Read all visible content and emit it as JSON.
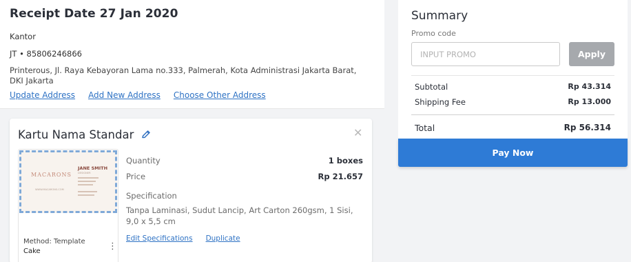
{
  "address": {
    "receipt_title": "Receipt Date 27 Jan 2020",
    "name": "Kantor",
    "phone": "JT • 85806246866",
    "line": "Printerous, Jl. Raya Kebayoran Lama no.333, Palmerah, Kota Administrasi Jakarta Barat, DKI Jakarta",
    "links": [
      "Update Address",
      "Add New Address",
      "Choose Other Address"
    ]
  },
  "product": {
    "title": "Kartu Nama Standar",
    "preview": {
      "logo": "MACARONS",
      "logo_sub": "WWW.MACARONS.COM",
      "name": "JANE SMITH",
      "role": "DESIGNER"
    },
    "method_label": "Method: Template",
    "method_value": "Cake",
    "quantity_label": "Quantity",
    "quantity_value": "1 boxes",
    "price_label": "Price",
    "price_value": "Rp 21.657",
    "spec_label": "Specification",
    "spec_text": "Tanpa Laminasi, Sudut Lancip, Art Carton 260gsm, 1 Sisi, 9,0 x 5,5 cm",
    "links": [
      "Edit Specifications",
      "Duplicate"
    ]
  },
  "summary": {
    "title": "Summary",
    "promo_label": "Promo code",
    "promo_placeholder": "INPUT PROMO",
    "apply_label": "Apply",
    "subtotal_label": "Subtotal",
    "subtotal_value": "Rp 43.314",
    "shipping_label": "Shipping Fee",
    "shipping_value": "Rp 13.000",
    "total_label": "Total",
    "total_value": "Rp 56.314"
  },
  "pay_button": "Pay Now",
  "icons": {
    "edit": "pencil-icon",
    "close": "close-icon",
    "menu": "kebab-menu-icon"
  },
  "colors": {
    "accent": "#2e7bd6",
    "link": "#2e72c4",
    "apply_disabled": "#a6a9ad"
  }
}
